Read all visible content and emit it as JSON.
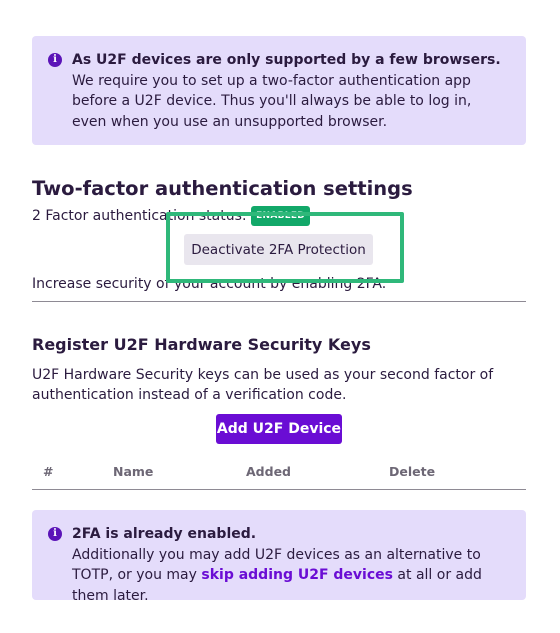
{
  "alert_top": {
    "title": "As U2F devices are only supported by a few browsers.",
    "body": "We require you to set up a two-factor authentication app before a U2F device. Thus you'll always be able to log in, even when you use an unsupported browser."
  },
  "twofa": {
    "title": "Two-factor authentication settings",
    "status_label": "2 Factor authentication status:",
    "status_badge": "ENABLED",
    "deactivate_label": "Deactivate 2FA Protection",
    "increase_text": "Increase security of your account by enabling 2FA."
  },
  "u2f": {
    "title": "Register U2F Hardware Security Keys",
    "description": "U2F Hardware Security keys can be used as your second factor of authentication instead of a verification code.",
    "add_label": "Add U2F Device",
    "columns": [
      "#",
      "Name",
      "Added",
      "Delete"
    ]
  },
  "alert_bottom": {
    "title": "2FA is already enabled.",
    "body_pre": "Additionally you may add U2F devices as an alternative to TOTP, or you may ",
    "link": "skip adding U2F devices",
    "body_post": " at all or add them later."
  },
  "colors": {
    "accent": "#6a0dd4",
    "alert_bg": "#e4dcfb",
    "success": "#12a869",
    "highlight": "#2fb87a"
  }
}
